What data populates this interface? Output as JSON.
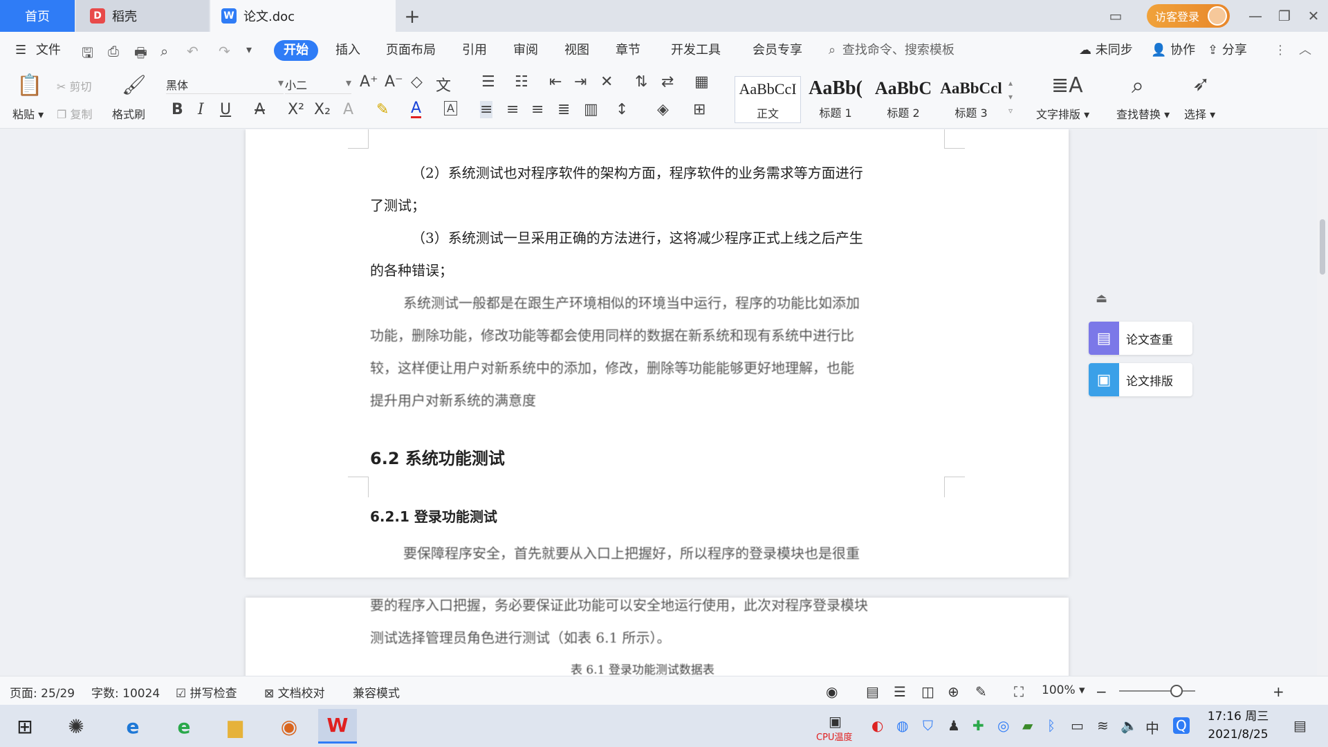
{
  "tabs": {
    "home": "首页",
    "daoke": "稻壳",
    "doc": "论文.doc",
    "add": "+"
  },
  "header": {
    "login": "访客登录",
    "minimize": "—",
    "restore": "❐",
    "close": "✕"
  },
  "menu": {
    "file": "文件",
    "items": [
      "开始",
      "插入",
      "页面布局",
      "引用",
      "审阅",
      "视图",
      "章节",
      "开发工具",
      "会员专享"
    ],
    "search_placeholder": "查找命令、搜索模板",
    "sync": "未同步",
    "collab": "协作",
    "share": "分享"
  },
  "ribbon": {
    "paste": "粘贴",
    "cut": "剪切",
    "copy": "复制",
    "format_painter": "格式刷",
    "font_name": "黑体",
    "font_size": "小二",
    "styles": [
      {
        "sample": "AaBbCcI",
        "name": "正文"
      },
      {
        "sample": "AaBb(",
        "name": "标题 1"
      },
      {
        "sample": "AaBbC",
        "name": "标题 2"
      },
      {
        "sample": "AaBbCcl",
        "name": "标题 3"
      }
    ],
    "text_layout": "文字排版",
    "find_replace": "查找替换",
    "select": "选择"
  },
  "document": {
    "p1_line1": "（2）系统测试也对程序软件的架构方面，程序软件的业务需求等方面进行",
    "p1_line2": "了测试；",
    "p2_line1": "（3）系统测试一旦采用正确的方法进行，这将减少程序正式上线之后产生",
    "p2_line2": "的各种错误；",
    "p3_line1": "系统测试一般都是在跟生产环境相似的环境当中运行，程序的功能比如添加",
    "p3_line2": "功能，删除功能，修改功能等都会使用同样的数据在新系统和现有系统中进行比",
    "p3_line3": "较，这样便让用户对新系统中的添加，修改，删除等功能能够更好地理解，也能",
    "p3_line4": "提升用户对新系统的满意度",
    "heading_62": "6.2  系统功能测试",
    "heading_621": "6.2.1  登录功能测试",
    "p4_line1": "要保障程序安全，首先就要从入口上把握好，所以程序的登录模块也是很重",
    "p4_line2": "要的程序入口把握，务必要保证此功能可以安全地运行使用，此次对程序登录模块",
    "p4_line3": "测试选择管理员角色进行测试（如表 6.1 所示）。",
    "table_caption": "表 6.1  登录功能测试数据表"
  },
  "side_panel": {
    "check": "论文查重",
    "layout": "论文排版"
  },
  "status": {
    "page": "页面: 25/29",
    "words": "字数: 10024",
    "spell": "拼写检查",
    "proof": "文档校对",
    "compat": "兼容模式",
    "zoom": "100%",
    "zoom_level": 0.75
  },
  "taskbar": {
    "time": "17:16 周三",
    "date": "2021/8/25",
    "ime": "中",
    "cpu": "CPU温度"
  },
  "colors": {
    "accent": "#2f7cf6",
    "login": "#e8872a",
    "check_icon": "#7b78e8",
    "layout_icon": "#3aa0e8"
  }
}
